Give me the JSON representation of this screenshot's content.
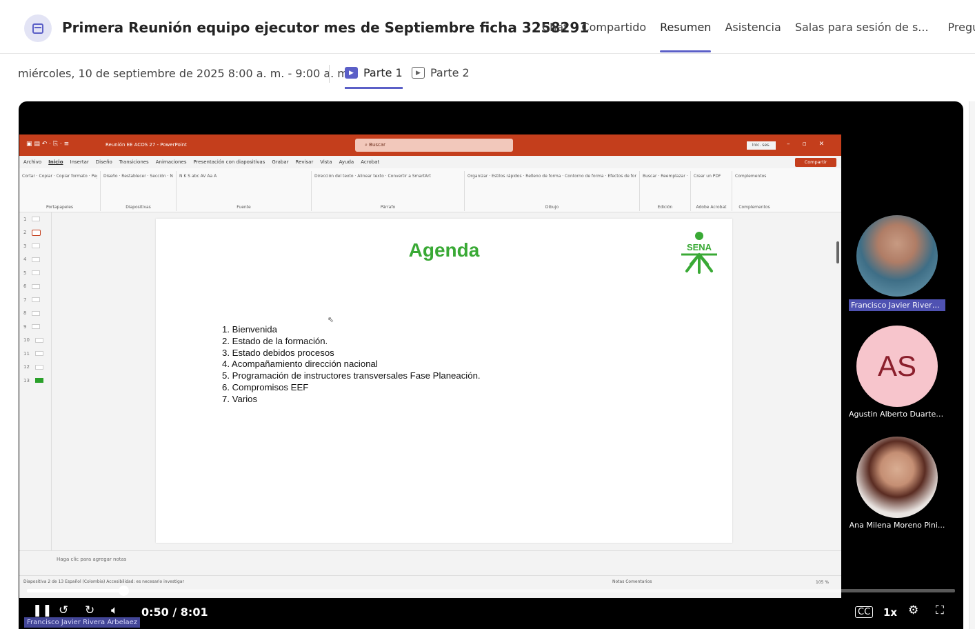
{
  "header": {
    "title": "Primera Reunión equipo ejecutor mes de Septiembre ficha 3258291",
    "tabs": [
      {
        "label": "Chat",
        "active": false
      },
      {
        "label": "Compartido",
        "active": false
      },
      {
        "label": "Resumen",
        "active": true
      },
      {
        "label": "Asistencia",
        "active": false
      },
      {
        "label": "Salas para sesión de s...",
        "active": false
      },
      {
        "label": "Preguntas",
        "active": false
      }
    ]
  },
  "recording": {
    "date_time": "miércoles, 10 de septiembre de 2025 8:00 a. m. - 9:00 a. m.",
    "parts": [
      {
        "label": "Parte 1",
        "active": true
      },
      {
        "label": "Parte 2",
        "active": false
      }
    ]
  },
  "powerpoint": {
    "window_title": "Reunión EE ACOS 27 - PowerPoint",
    "search_placeholder": "Buscar",
    "signin": "Inic. ses.",
    "share_label": "Compartir",
    "menu": [
      "Archivo",
      "Inicio",
      "Insertar",
      "Diseño",
      "Transiciones",
      "Animaciones",
      "Presentación con diapositivas",
      "Grabar",
      "Revisar",
      "Vista",
      "Ayuda",
      "Acrobat"
    ],
    "ribbon_groups": [
      {
        "label": "Portapapeles",
        "items": "Cortar · Copiar · Copiar formato · Pegar"
      },
      {
        "label": "Diapositivas",
        "items": "Diseño · Restablecer · Sección · Nueva diapositiva"
      },
      {
        "label": "Fuente",
        "items": "N K S abc AV Aa A"
      },
      {
        "label": "Párrafo",
        "items": "Dirección del texto · Alinear texto · Convertir a SmartArt"
      },
      {
        "label": "Dibujo",
        "items": "Organizar · Estilos rápidos · Relleno de forma · Contorno de forma · Efectos de forma"
      },
      {
        "label": "Edición",
        "items": "Buscar · Reemplazar · Seleccionar"
      },
      {
        "label": "Adobe Acrobat",
        "items": "Crear un PDF"
      },
      {
        "label": "Complementos",
        "items": "Complementos"
      }
    ],
    "slide_numbers": [
      "1",
      "2",
      "3",
      "4",
      "5",
      "6",
      "7",
      "8",
      "9",
      "10",
      "11",
      "12",
      "13"
    ],
    "slide": {
      "title": "Agenda",
      "logo_text": "SENA",
      "items": [
        "1. Bienvenida",
        "2. Estado de la formación.",
        "3. Estado debidos procesos",
        "4. Acompañamiento dirección nacional",
        "5. Programación de instructores transversales Fase Planeación.",
        "6. Compromisos EEF",
        "7. Varios"
      ]
    },
    "notes_placeholder": "Haga clic para agregar notas",
    "status_left": "Diapositiva 2 de 13    Español (Colombia)    Accesibilidad: es necesario investigar",
    "status_right": "Notas    Comentarios",
    "zoom": "105 %"
  },
  "participants": [
    {
      "name": "Francisco Javier Rivera ...",
      "initials": "",
      "highlighted": true
    },
    {
      "name": "Agustin Alberto Duarte ...",
      "initials": "AS",
      "highlighted": false
    },
    {
      "name": "Ana Milena Moreno Pini...",
      "initials": "",
      "highlighted": false
    }
  ],
  "player": {
    "current_time": "0:50",
    "duration": "8:01",
    "time_display": "0:50 / 8:01",
    "progress_fraction": 0.104,
    "speed": "1x",
    "presenter_tag": "Francisco Javier Rivera Arbelaez"
  },
  "colors": {
    "accent": "#5b5fc7",
    "ppt_red": "#c43e1c",
    "agenda_green": "#39a935"
  },
  "icons": [
    "calendar-icon",
    "play-icon",
    "pause-icon",
    "rewind-10-icon",
    "forward-10-icon",
    "volume-icon",
    "captions-icon",
    "settings-icon",
    "fullscreen-icon"
  ]
}
